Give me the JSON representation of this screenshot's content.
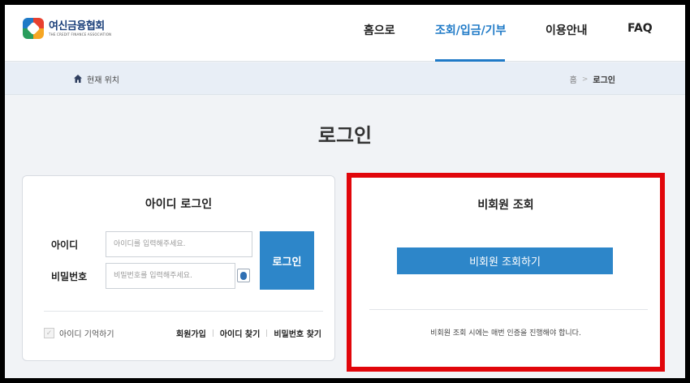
{
  "header": {
    "logo_title": "여신금융협회",
    "logo_subtitle": "THE CREDIT FINANCE ASSOCIATION",
    "nav": [
      {
        "label": "홈으로"
      },
      {
        "label": "조회/입금/기부",
        "active": true
      },
      {
        "label": "이용안내"
      },
      {
        "label": "FAQ"
      }
    ]
  },
  "breadcrumb": {
    "current_location_label": "현재 위치",
    "home": "홈",
    "separator": ">",
    "leaf": "로그인"
  },
  "page_title": "로그인",
  "login_card": {
    "title": "아이디 로그인",
    "id_label": "아이디",
    "id_value": "",
    "id_placeholder": "아이디를 입력해주세요.",
    "pw_label": "비밀번호",
    "pw_value": "",
    "pw_placeholder": "비밀번호를 입력해주세요.",
    "login_button": "로그인",
    "remember_label": "아이디 기억하기",
    "remember_checked": false,
    "links": {
      "signup": "회원가입",
      "find_id": "아이디 찾기",
      "find_pw": "비밀번호 찾기"
    }
  },
  "guest_card": {
    "title": "비회원 조회",
    "button": "비회원 조회하기",
    "note": "비회원 조회 시에는 매번 인증을 진행해야 합니다."
  },
  "colors": {
    "accent": "#2d86c9",
    "nav_active": "#1f7ac7",
    "highlight_frame": "#e1060b",
    "breadcrumb_bg": "#e8eef6"
  },
  "icons": [
    "logo-icon",
    "home-icon",
    "keyboard-icon",
    "checkbox-icon"
  ]
}
